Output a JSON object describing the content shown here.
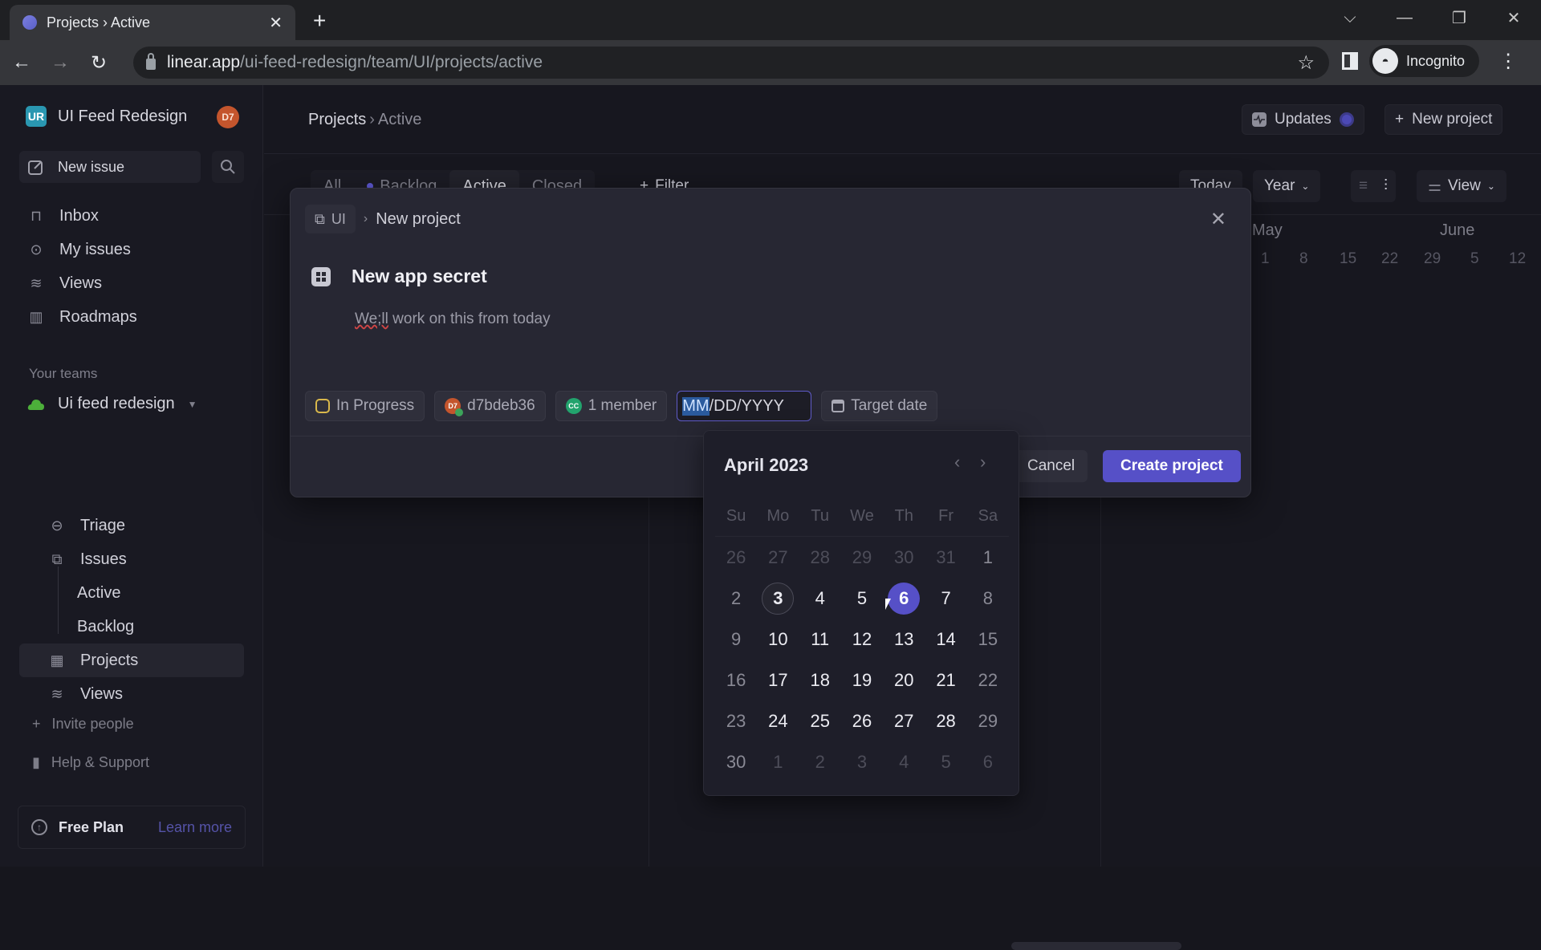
{
  "browser": {
    "tab_title": "Projects › Active",
    "url_host": "linear.app",
    "url_path": "/ui-feed-redesign/team/UI/projects/active",
    "profile_label": "Incognito"
  },
  "sidebar": {
    "workspace_initials": "UR",
    "workspace_name": "UI Feed Redesign",
    "user_avatar": "D7",
    "new_issue_label": "New issue",
    "nav_items": [
      {
        "label": "Inbox",
        "icon": "inbox-icon"
      },
      {
        "label": "My issues",
        "icon": "my-issues-icon"
      },
      {
        "label": "Views",
        "icon": "views-icon"
      },
      {
        "label": "Roadmaps",
        "icon": "roadmap-icon"
      }
    ],
    "teams_section_label": "Your teams",
    "team_name": "Ui feed redesign",
    "team_items": [
      {
        "label": "Triage",
        "icon": "triage-icon"
      },
      {
        "label": "Issues",
        "icon": "issues-icon"
      },
      {
        "label": "Active",
        "icon": ""
      },
      {
        "label": "Backlog",
        "icon": ""
      },
      {
        "label": "Projects",
        "icon": "projects-icon",
        "active": true
      },
      {
        "label": "Views",
        "icon": "views-icon"
      }
    ],
    "invite_label": "Invite people",
    "help_label": "Help & Support",
    "plan_label": "Free Plan",
    "learn_more_label": "Learn more"
  },
  "header": {
    "breadcrumb_root": "Projects",
    "breadcrumb_separator": "›",
    "breadcrumb_current": "Active",
    "updates_label": "Updates",
    "new_project_label": "New project"
  },
  "filters": {
    "tabs": [
      "All",
      "Backlog",
      "Active",
      "Closed"
    ],
    "active_tab": "Active",
    "filter_label": "Filter",
    "today_label": "Today",
    "zoom_label": "Year",
    "view_label": "View"
  },
  "timeline": {
    "months": [
      "May",
      "June"
    ],
    "days": [
      "1",
      "8",
      "15",
      "22",
      "29",
      "5",
      "12"
    ]
  },
  "modal": {
    "team_label": "UI",
    "crumb_separator": "›",
    "crumb_title": "New project",
    "project_name": "New app secret",
    "description_misspelled": "We;ll",
    "description_rest": " work on this from today",
    "status_label": "In Progress",
    "lead_avatar": "D7",
    "lead_label": "d7bdeb36",
    "members_avatar": "CC",
    "members_label": "1 member",
    "start_date_highlight": "MM",
    "start_date_rest": "/DD/YYYY",
    "target_date_label": "Target date",
    "cancel_label": "Cancel",
    "create_label": "Create project"
  },
  "calendar": {
    "month_label": "April 2023",
    "weekdays": [
      "Su",
      "Mo",
      "Tu",
      "We",
      "Th",
      "Fr",
      "Sa"
    ],
    "weeks": [
      [
        {
          "d": "26",
          "t": "other"
        },
        {
          "d": "27",
          "t": "other"
        },
        {
          "d": "28",
          "t": "other"
        },
        {
          "d": "29",
          "t": "other"
        },
        {
          "d": "30",
          "t": "other"
        },
        {
          "d": "31",
          "t": "other"
        },
        {
          "d": "1",
          "t": "weekend"
        }
      ],
      [
        {
          "d": "2",
          "t": "weekend"
        },
        {
          "d": "3",
          "t": "today"
        },
        {
          "d": "4",
          "t": "week"
        },
        {
          "d": "5",
          "t": "week"
        },
        {
          "d": "6",
          "t": "selected"
        },
        {
          "d": "7",
          "t": "week"
        },
        {
          "d": "8",
          "t": "weekend"
        }
      ],
      [
        {
          "d": "9",
          "t": "weekend"
        },
        {
          "d": "10",
          "t": "week"
        },
        {
          "d": "11",
          "t": "week"
        },
        {
          "d": "12",
          "t": "week"
        },
        {
          "d": "13",
          "t": "week"
        },
        {
          "d": "14",
          "t": "week"
        },
        {
          "d": "15",
          "t": "weekend"
        }
      ],
      [
        {
          "d": "16",
          "t": "weekend"
        },
        {
          "d": "17",
          "t": "week"
        },
        {
          "d": "18",
          "t": "week"
        },
        {
          "d": "19",
          "t": "week"
        },
        {
          "d": "20",
          "t": "week"
        },
        {
          "d": "21",
          "t": "week"
        },
        {
          "d": "22",
          "t": "weekend"
        }
      ],
      [
        {
          "d": "23",
          "t": "weekend"
        },
        {
          "d": "24",
          "t": "week"
        },
        {
          "d": "25",
          "t": "week"
        },
        {
          "d": "26",
          "t": "week"
        },
        {
          "d": "27",
          "t": "week"
        },
        {
          "d": "28",
          "t": "week"
        },
        {
          "d": "29",
          "t": "weekend"
        }
      ],
      [
        {
          "d": "30",
          "t": "weekend"
        },
        {
          "d": "1",
          "t": "other"
        },
        {
          "d": "2",
          "t": "other"
        },
        {
          "d": "3",
          "t": "other"
        },
        {
          "d": "4",
          "t": "other"
        },
        {
          "d": "5",
          "t": "other"
        },
        {
          "d": "6",
          "t": "other"
        }
      ]
    ]
  },
  "colors": {
    "accent": "#5650c7",
    "team_icon": "#4caf3a",
    "avatar": "#c4552d"
  }
}
